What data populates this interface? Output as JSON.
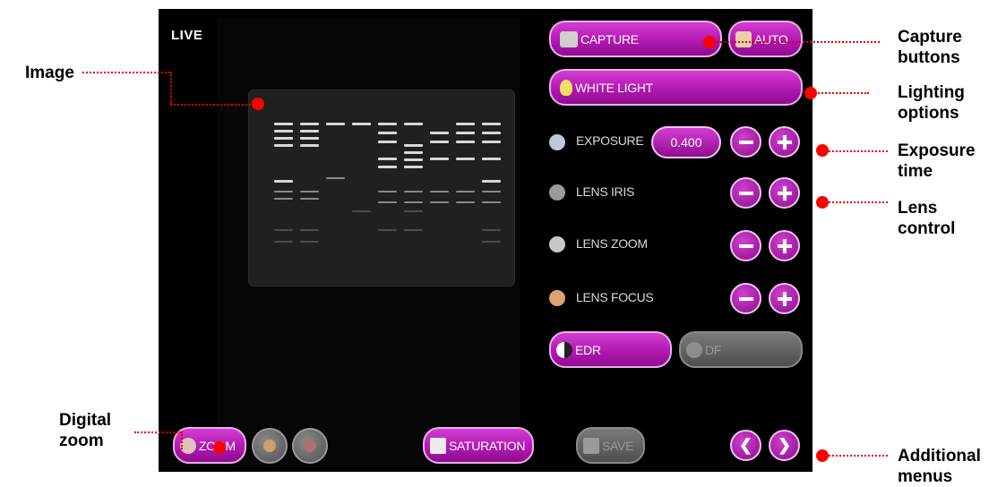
{
  "screen": {
    "live_label": "LIVE",
    "capture_label": "CAPTURE",
    "auto_label": "AUTO",
    "white_light_label": "WHITE LIGHT",
    "exposure_label": "EXPOSURE",
    "exposure_value": "0.400",
    "lens_iris_label": "LENS IRIS",
    "lens_zoom_label": "LENS ZOOM",
    "lens_focus_label": "LENS FOCUS",
    "edr_label": "EDR",
    "df_label": "DF",
    "zoom_label": "ZOOM",
    "saturation_label": "SATURATION",
    "save_label": "SAVE"
  },
  "annotations": {
    "image": "Image",
    "capture": [
      "Capture",
      "buttons"
    ],
    "lighting": [
      "Lighting",
      "options"
    ],
    "exposure": [
      "Exposure",
      "time"
    ],
    "lens": [
      "Lens",
      "control"
    ],
    "digital_zoom": [
      "Digital",
      "zoom"
    ],
    "additional": [
      "Additional",
      "menus"
    ]
  },
  "colors": {
    "accent": "#b218b2",
    "marker": "#ff0000",
    "panel": "#000000"
  },
  "icons": [
    "camera-icon",
    "auto-icon",
    "bulb-icon",
    "stopwatch-icon",
    "iris-icon",
    "magnifier-icon",
    "eye-icon",
    "half-moon-icon",
    "df-icon",
    "zoom-icon",
    "saturation-icon",
    "save-icon",
    "arrow-left-icon",
    "arrow-right-icon"
  ]
}
